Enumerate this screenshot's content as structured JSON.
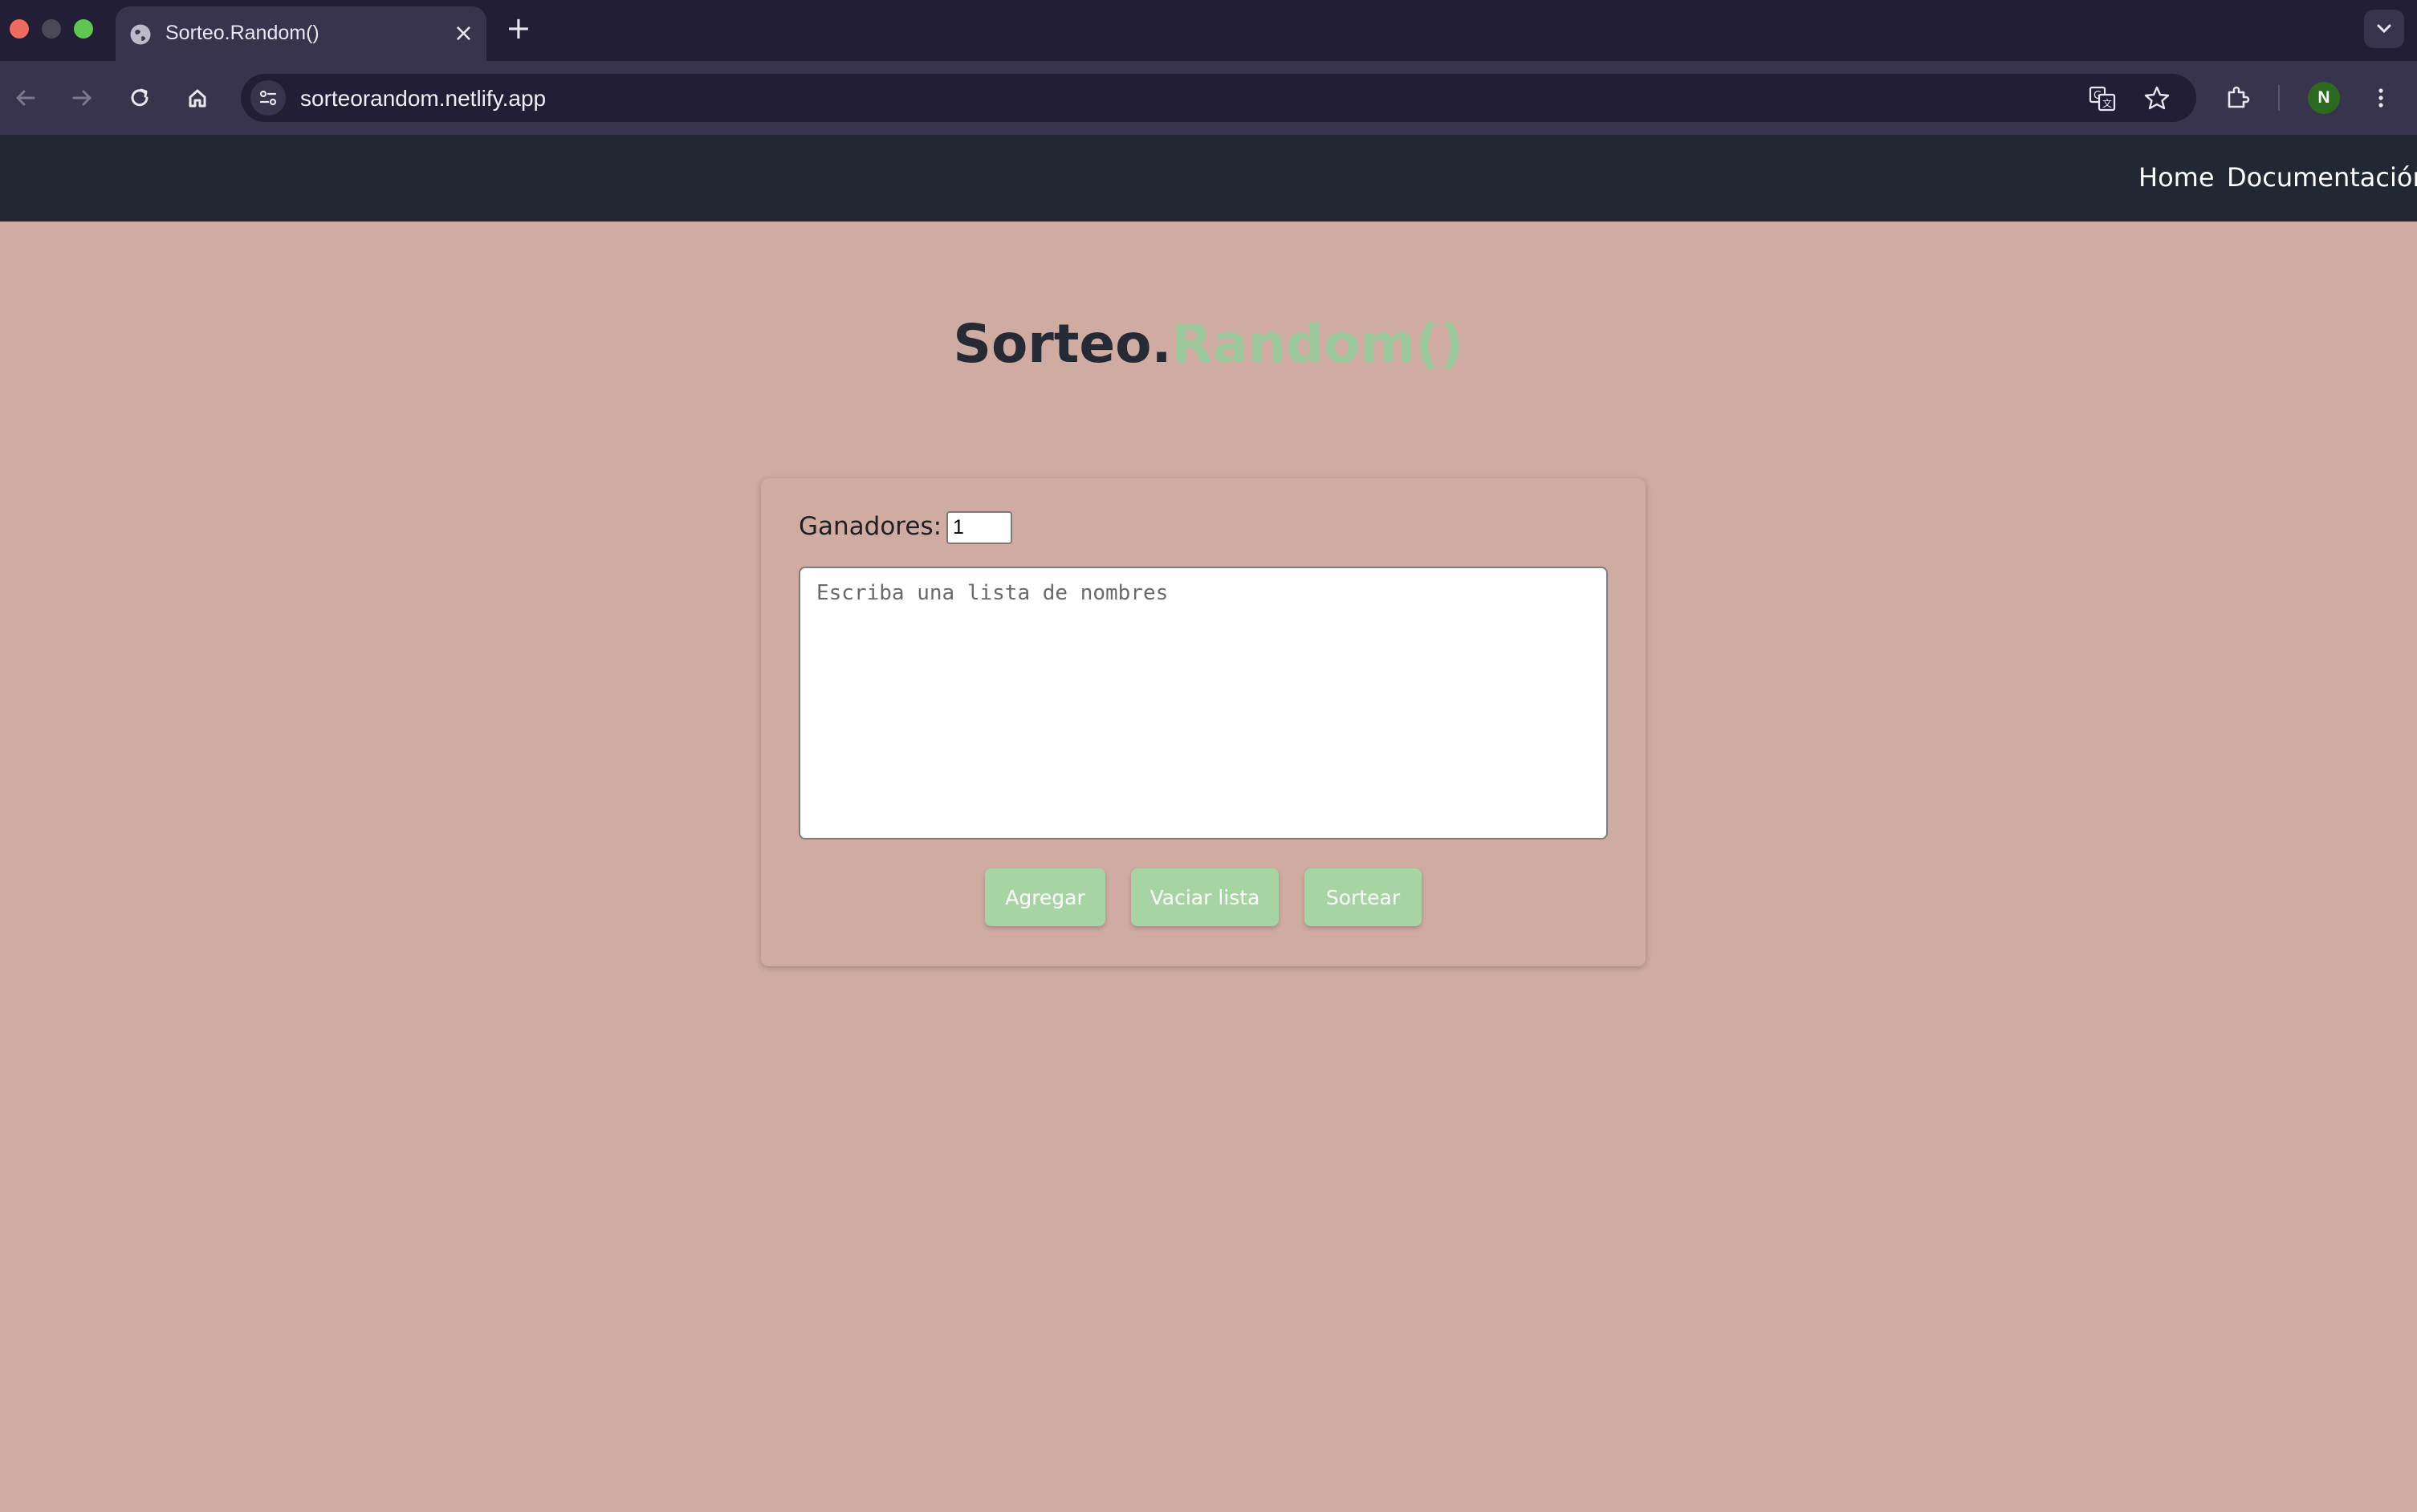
{
  "browser": {
    "tab_title": "Sorteo.Random()",
    "new_tab_symbol": "+",
    "close_symbol": "×",
    "url": "sorteorandom.netlify.app",
    "profile_initial": "N"
  },
  "nav": {
    "links": [
      "Home",
      "Documentación"
    ]
  },
  "header": {
    "title_main": "Sorteo.",
    "title_accent": "Random()"
  },
  "form": {
    "winners_label": "Ganadores:",
    "winners_value": "1",
    "names_placeholder": "Escriba una lista de nombres",
    "buttons": {
      "add": "Agregar",
      "clear": "Vaciar lista",
      "draw": "Sortear"
    }
  },
  "colors": {
    "page_background": "#cfaba1",
    "navbar": "#212733",
    "accent_green": "#9cc69b",
    "button_green": "#a6d4a2"
  },
  "icons": [
    "globe-icon",
    "back-icon",
    "forward-icon",
    "reload-icon",
    "home-icon",
    "site-info-icon",
    "translate-icon",
    "bookmark-star-icon",
    "extensions-icon",
    "more-menu-icon",
    "tab-list-icon"
  ]
}
